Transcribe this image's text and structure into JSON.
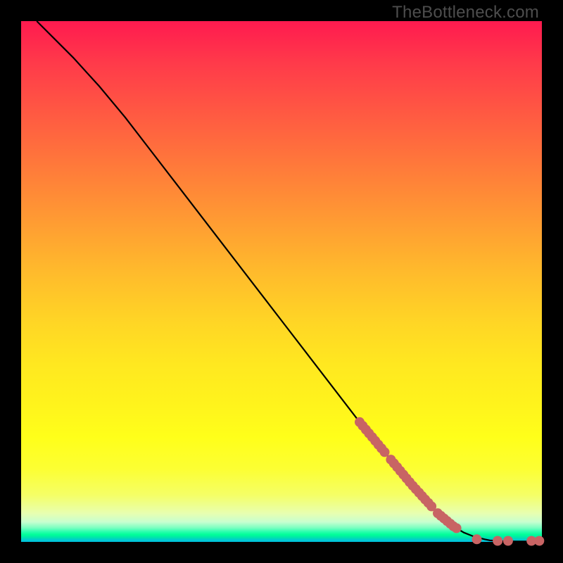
{
  "watermark": "TheBottleneck.com",
  "chart_data": {
    "type": "line",
    "title": "",
    "xlabel": "",
    "ylabel": "",
    "xlim": [
      0,
      100
    ],
    "ylim": [
      0,
      100
    ],
    "grid": false,
    "legend": false,
    "series": [
      {
        "name": "curve",
        "color": "#000000",
        "x": [
          3,
          6,
          10,
          15,
          20,
          25,
          30,
          35,
          40,
          45,
          50,
          55,
          60,
          65,
          70,
          75,
          80,
          83,
          85,
          87,
          89,
          90,
          92,
          95,
          98,
          100
        ],
        "y": [
          100,
          97,
          93,
          87.5,
          81.5,
          75,
          68.5,
          62,
          55.5,
          49,
          42.5,
          36,
          29.5,
          23,
          17,
          11,
          5.5,
          3,
          1.8,
          1.0,
          0.5,
          0.3,
          0.15,
          0.1,
          0.1,
          0.1
        ]
      }
    ],
    "markers": [
      {
        "name": "marker-segment",
        "x_range": [
          65,
          70
        ],
        "along_curve": true
      },
      {
        "name": "marker-segment",
        "x_range": [
          71,
          79
        ],
        "along_curve": true
      },
      {
        "name": "marker-segment",
        "x_range": [
          80,
          84
        ],
        "along_curve": true
      },
      {
        "name": "marker-dot",
        "x": 87.5,
        "y": 0.5
      },
      {
        "name": "marker-dot",
        "x": 91.5,
        "y": 0.2
      },
      {
        "name": "marker-dot",
        "x": 93.5,
        "y": 0.2
      },
      {
        "name": "marker-dot",
        "x": 98.0,
        "y": 0.2
      },
      {
        "name": "marker-dot",
        "x": 99.5,
        "y": 0.2
      }
    ],
    "marker_color": "#c86464"
  }
}
